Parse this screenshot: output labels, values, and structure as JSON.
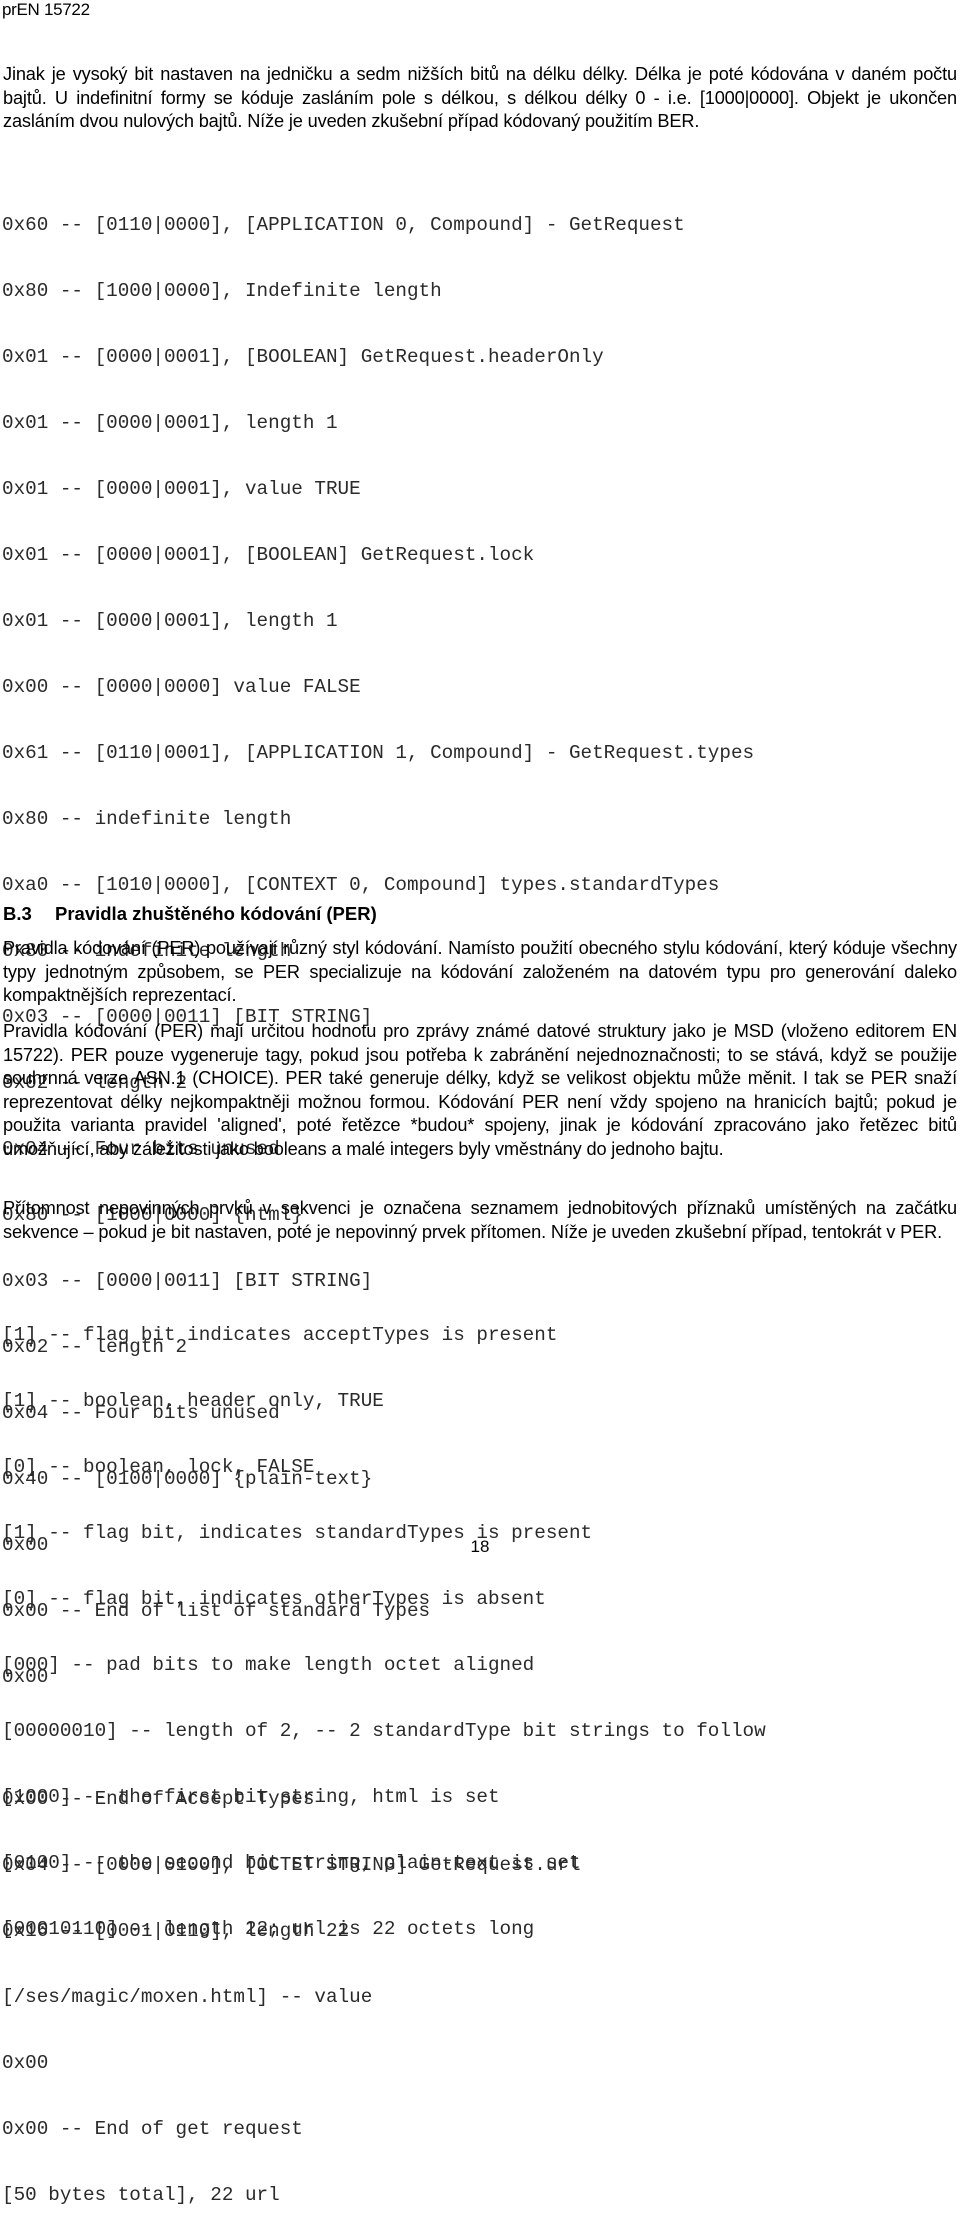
{
  "header": {
    "doc_id": "prEN 15722"
  },
  "intro_paragraph": "Jinak je vysoký bit nastaven na jedničku a sedm nižších bitů na délku délky. Délka je poté kódována v daném počtu bajtů. U indefinitní formy se kóduje zasláním pole s délkou, s délkou délky 0 - i.e. [1000|0000]. Objekt je ukončen zasláním dvou nulových bajtů. Níže je uveden zkušební případ kódovaný použitím BER.",
  "ber_listing": {
    "block1": [
      "0x60 -- [0110|0000], [APPLICATION 0, Compound] - GetRequest",
      "0x80 -- [1000|0000], Indefinite length",
      "0x01 -- [0000|0001], [BOOLEAN] GetRequest.headerOnly",
      "0x01 -- [0000|0001], length 1",
      "0x01 -- [0000|0001], value TRUE",
      "0x01 -- [0000|0001], [BOOLEAN] GetRequest.lock",
      "0x01 -- [0000|0001], length 1",
      "0x00 -- [0000|0000] value FALSE",
      "0x61 -- [0110|0001], [APPLICATION 1, Compound] - GetRequest.types",
      "0x80 -- indefinite length",
      "0xa0 -- [1010|0000], [CONTEXT 0, Compound] types.standardTypes",
      "0x80 -- indefinite length",
      "0x03 -- [0000|0011] [BIT STRING]",
      "0x02 -- length 2",
      "0x04 -- Four bits unused",
      "0x80 -- [1000|0000] {html}",
      "0x03 -- [0000|0011] [BIT STRING]",
      "0x02 -- length 2",
      "0x04 -- Four bits unused",
      "0x40 -- [0100|0000] {plain-text}",
      "0x00",
      "0x00 -- End of list of standard Types",
      "0x00"
    ],
    "block2": [
      "0x00 -- End of Accept Types",
      "0x04 -- [0000|0100], [OCTET STRING] GetRequest.url",
      "0x16 -- [0001|0110], length 22",
      "[/ses/magic/moxen.html] -- value",
      "0x00",
      "0x00 -- End of get request",
      "[50 bytes total], 22 url"
    ]
  },
  "section": {
    "number": "B.3",
    "title": "Pravidla zhuštěného kódování (PER)"
  },
  "per_paragraphs": [
    "Pravidla kódování (PER) používají různý styl kódování. Namísto použití obecného stylu kódování, který kóduje všechny typy jednotným způsobem, se PER specializuje na kódování založeném na datovém typu pro generování daleko kompaktnějších reprezentací.",
    "Pravidla kódování (PER) mají určitou hodnotu pro zprávy známé datové struktury jako je MSD (vloženo editorem EN 15722). PER pouze vygeneruje tagy, pokud jsou potřeba k zabránění nejednoznačnosti; to se stává, když se použije souhrnná verze ASN.1 (CHOICE). PER také generuje délky, když se velikost objektu může měnit. I tak se PER snaží reprezentovat délky nejkompaktněji možnou formou. Kódování PER není vždy spojeno na hranicích bajtů; pokud je použita varianta pravidel 'aligned', poté řetězce *budou* spojeny, jinak je kódování zpracováno jako řetězec bitů umožňující, aby záležitosti jako booleans a malé integers byly vměstnány do jednoho bajtu.",
    "Přítomnost nepovinných prvků v sekvenci je označena seznamem jednobitových příznaků umístěných na začátku sekvence – pokud je bit nastaven, poté je nepovinný prvek přítomen. Níže je uveden zkušební případ, tentokrát v PER."
  ],
  "per_listing": [
    "[1] -- flag bit indicates acceptTypes is present",
    "[1] -- boolean, header only, TRUE",
    "[0] -- boolean, lock, FALSE",
    "[1] -- flag bit, indicates standardTypes is present",
    "[0] -- flag bit, indicates otherTypes is absent",
    "[000] -- pad bits to make length octet aligned",
    "[00000010] -- length of 2, -- 2 standardType bit strings to follow",
    "[1000] -- the first bit string, html is set",
    "[0100] -- the second bit string, plain-text is set",
    "[00010110] -- length 22; url is 22 octets long"
  ],
  "footer": {
    "page_number": "18"
  }
}
